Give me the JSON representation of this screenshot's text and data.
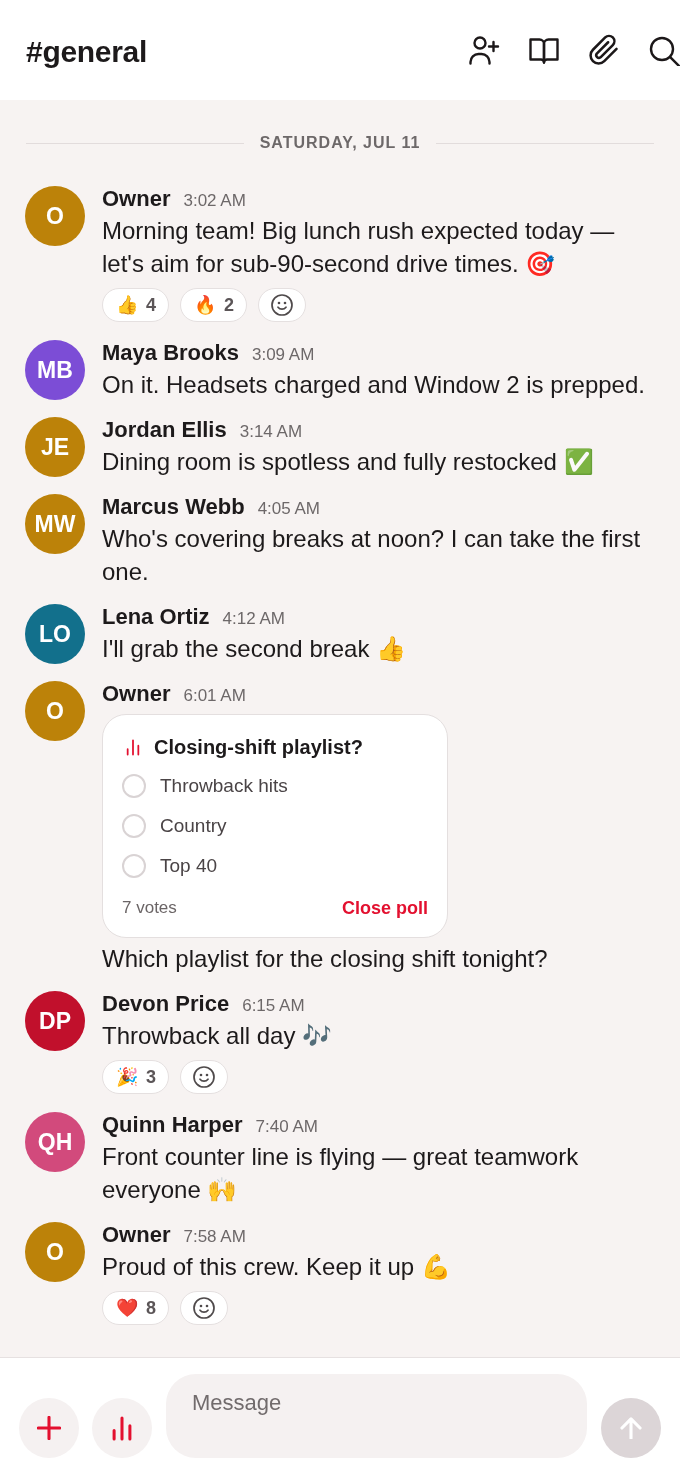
{
  "header": {
    "title": "#general"
  },
  "date_divider": "SATURDAY, JUL 11",
  "messages": [
    {
      "author": "Owner",
      "initials": "O",
      "color": "#bc8209",
      "time": "3:02 AM",
      "text": "Morning team! Big lunch rush expected today — let's aim for sub-90-second drive times. 🎯",
      "reactions": [
        {
          "emoji": "👍",
          "count": "4"
        },
        {
          "emoji": "🔥",
          "count": "2"
        }
      ]
    },
    {
      "author": "Maya Brooks",
      "initials": "MB",
      "color": "#7c4dd6",
      "time": "3:09 AM",
      "text": "On it. Headsets charged and Window 2 is prepped."
    },
    {
      "author": "Jordan Ellis",
      "initials": "JE",
      "color": "#bc8209",
      "time": "3:14 AM",
      "text": "Dining room is spotless and fully restocked ✅"
    },
    {
      "author": "Marcus Webb",
      "initials": "MW",
      "color": "#bc8209",
      "time": "4:05 AM",
      "text": "Who's covering breaks at noon? I can take the first one."
    },
    {
      "author": "Lena Ortiz",
      "initials": "LO",
      "color": "#12708c",
      "time": "4:12 AM",
      "text": "I'll grab the second break 👍"
    },
    {
      "author": "Owner",
      "initials": "O",
      "color": "#bc8209",
      "time": "6:01 AM",
      "poll": {
        "title": "Closing-shift playlist?",
        "options": [
          {
            "label": "Throwback hits",
            "selected": false
          },
          {
            "label": "Country",
            "selected": false
          },
          {
            "label": "Top 40",
            "selected": false
          }
        ],
        "votes": "7 votes",
        "action": "Close poll"
      },
      "text": "Which playlist for the closing shift tonight?"
    },
    {
      "author": "Devon Price",
      "initials": "DP",
      "color": "#c1102c",
      "time": "6:15 AM",
      "text": "Throwback all day 🎶",
      "reactions": [
        {
          "emoji": "🎉",
          "count": "3"
        }
      ]
    },
    {
      "author": "Quinn Harper",
      "initials": "QH",
      "color": "#d24a7c",
      "time": "7:40 AM",
      "text": "Front counter line is flying — great teamwork everyone 🙌"
    },
    {
      "author": "Owner",
      "initials": "O",
      "color": "#bc8209",
      "time": "7:58 AM",
      "text": "Proud of this crew. Keep it up 💪",
      "reactions": [
        {
          "emoji": "❤️",
          "count": "8"
        }
      ]
    }
  ],
  "composer": {
    "placeholder": "Message",
    "send_disabled": true
  }
}
